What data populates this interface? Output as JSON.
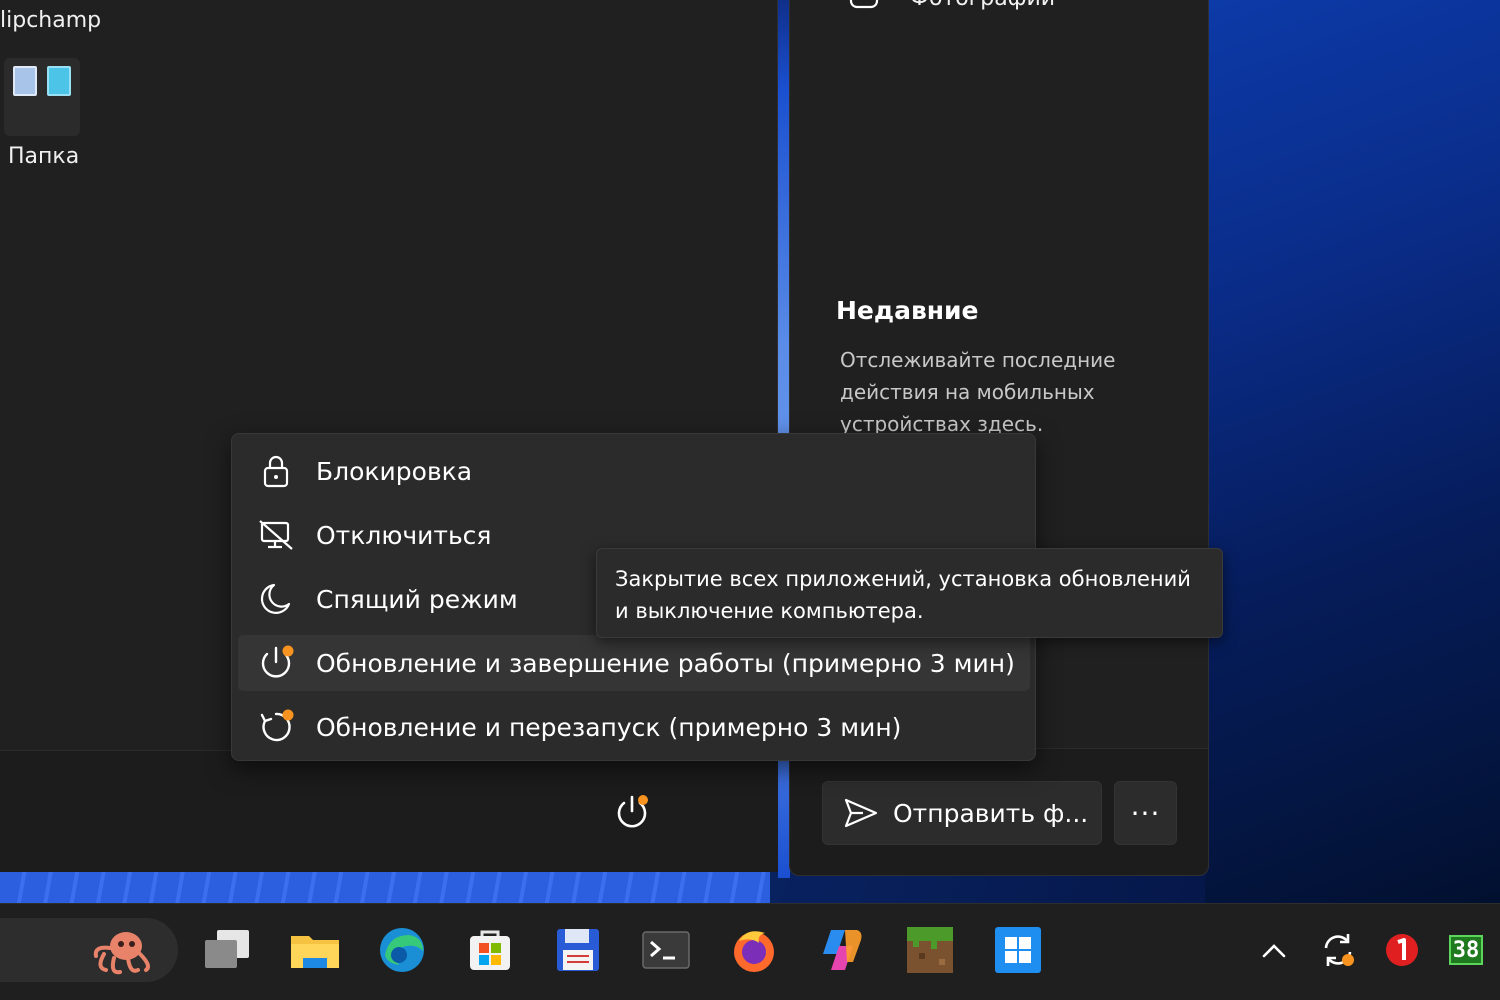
{
  "start_menu": {
    "top_app_label": "lipchamp",
    "folder_label": "Папка"
  },
  "side_panel": {
    "photos_label": "Фотографии",
    "recent_title": "Недавние",
    "recent_description": "Отслеживайте последние действия на мобильных устройствах здесь.",
    "send_button_label": "Отправить ф...",
    "more_button_label": "···"
  },
  "power_menu": {
    "items": [
      {
        "label": "Блокировка",
        "icon": "lock-icon"
      },
      {
        "label": "Отключиться",
        "icon": "sign-out-icon"
      },
      {
        "label": "Спящий режим",
        "icon": "sleep-moon-icon"
      },
      {
        "label": "Обновление и завершение работы (примерно 3 мин)",
        "icon": "update-shutdown-icon"
      },
      {
        "label": "Обновление и перезапуск (примерно 3 мин)",
        "icon": "update-restart-icon"
      }
    ],
    "tooltip": "Закрытие всех приложений, установка обновлений и выключение компьютера.",
    "badge_color": "#f7931e"
  },
  "taskbar": {
    "apps": [
      "task-view-icon",
      "file-explorer-icon",
      "edge-icon",
      "store-icon",
      "save-app-icon",
      "terminal-icon",
      "firefox-icon",
      "copilot-icon",
      "minecraft-icon",
      "start-icon"
    ],
    "tray": {
      "overflow_icon": "chevron-up-icon",
      "sync_icon": "sync-icon",
      "notification_icon": "red-badge-icon",
      "counter_text": "38"
    }
  }
}
